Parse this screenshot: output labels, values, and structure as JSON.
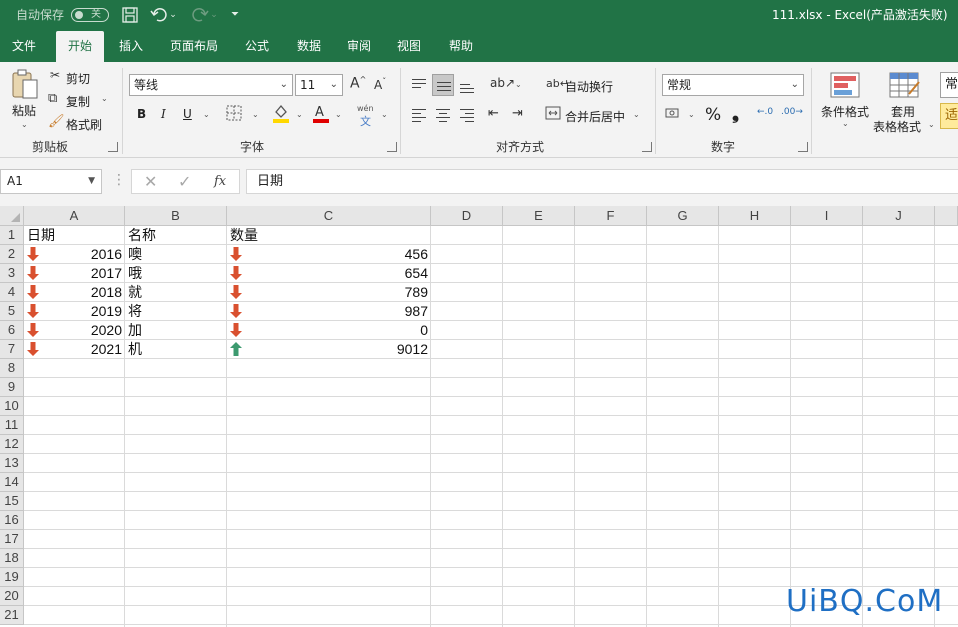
{
  "titlebar": {
    "autosave_label": "自动保存",
    "autosave_state": "关",
    "window_title": "111.xlsx  -  Excel(产品激活失败)"
  },
  "tabs": [
    "文件",
    "开始",
    "插入",
    "页面布局",
    "公式",
    "数据",
    "审阅",
    "视图",
    "帮助"
  ],
  "active_tab": "开始",
  "ribbon": {
    "clipboard": {
      "paste": "粘贴",
      "cut": "剪切",
      "copy": "复制",
      "format_painter": "格式刷",
      "label": "剪贴板"
    },
    "font": {
      "font_name": "等线",
      "font_size": "11",
      "bold": "B",
      "italic": "I",
      "underline": "U",
      "phonetic": "wén",
      "label": "字体"
    },
    "alignment": {
      "wrap_text": "自动换行",
      "merge_center": "合并后居中",
      "label": "对齐方式"
    },
    "number": {
      "format": "常规",
      "percent": "%",
      "comma": "❟",
      "label": "数字"
    },
    "styles": {
      "conditional_format_line1": "条件格式",
      "table_format_line1": "套用",
      "table_format_line2": "表格格式",
      "style_preview": "常",
      "style_preview_2": "适"
    }
  },
  "formula_bar": {
    "name_box": "A1",
    "fx": "fx",
    "content": "日期"
  },
  "columns": [
    "A",
    "B",
    "C",
    "D",
    "E",
    "F",
    "G",
    "H",
    "I",
    "J"
  ],
  "rows": [
    "1",
    "2",
    "3",
    "4",
    "5",
    "6",
    "7",
    "8",
    "9",
    "10",
    "11",
    "12",
    "13",
    "14",
    "15",
    "16",
    "17",
    "18",
    "19",
    "20",
    "21"
  ],
  "sheet": {
    "headers": [
      "日期",
      "名称",
      "数量"
    ],
    "data": [
      {
        "year": "2016",
        "name": "噢",
        "qty": "456",
        "year_icon": "down",
        "qty_icon": "down"
      },
      {
        "year": "2017",
        "name": "哦",
        "qty": "654",
        "year_icon": "down",
        "qty_icon": "down"
      },
      {
        "year": "2018",
        "name": "就",
        "qty": "789",
        "year_icon": "down",
        "qty_icon": "down"
      },
      {
        "year": "2019",
        "name": "将",
        "qty": "987",
        "year_icon": "down",
        "qty_icon": "down"
      },
      {
        "year": "2020",
        "name": "加",
        "qty": "0",
        "year_icon": "down",
        "qty_icon": "down"
      },
      {
        "year": "2021",
        "name": "机",
        "qty": "9012",
        "year_icon": "down",
        "qty_icon": "up"
      }
    ]
  },
  "colors": {
    "excel_green": "#217346",
    "arrow_down": "#d9502f",
    "arrow_up": "#3d9a6f"
  },
  "watermark": "UiBQ.CoM"
}
